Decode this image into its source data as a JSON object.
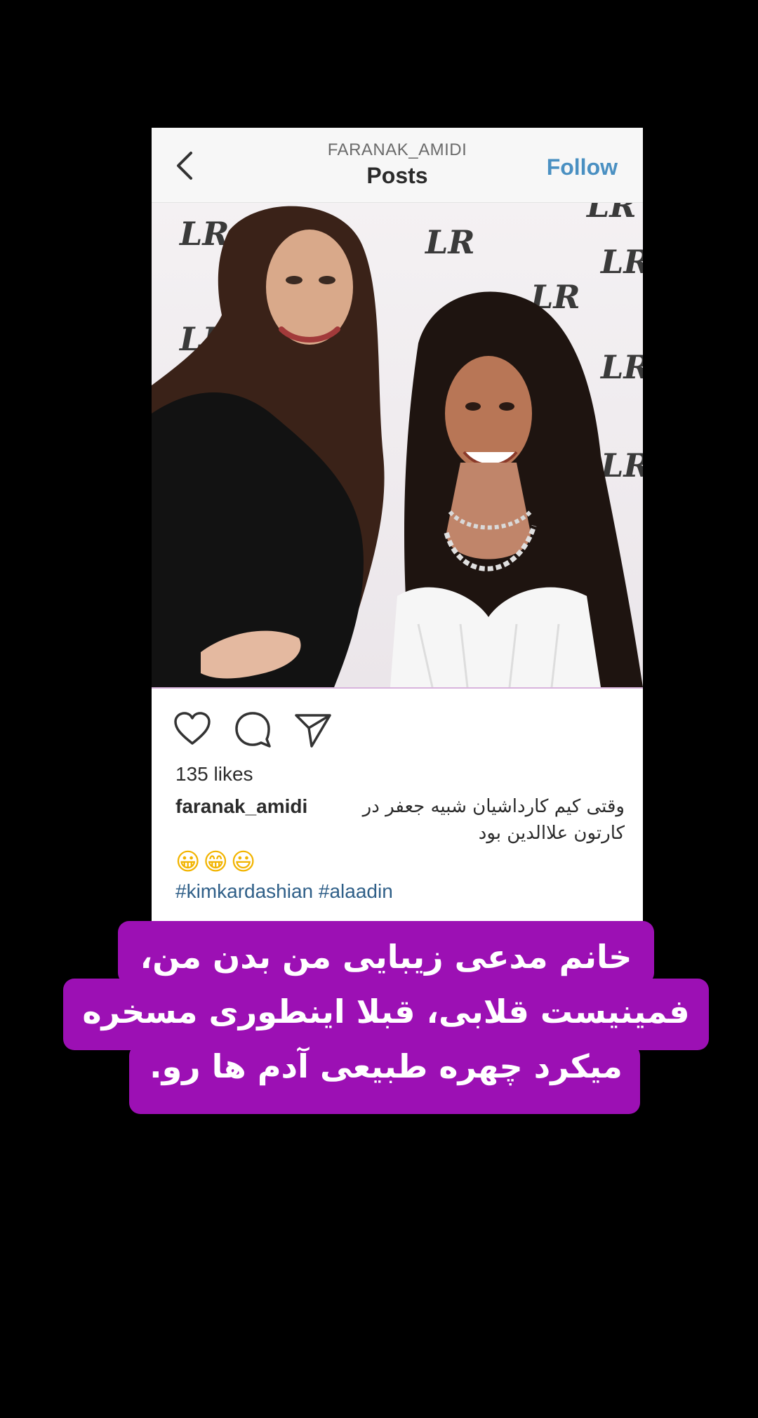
{
  "post_header": {
    "username": "FARANAK_AMIDI",
    "title": "Posts",
    "follow_label": "Follow",
    "back_icon": "chevron-left-icon"
  },
  "photo": {
    "backdrop_logo_text": "LR",
    "description_icon": "photo-of-two-women"
  },
  "actions": {
    "like_icon": "heart-icon",
    "comment_icon": "comment-bubble-icon",
    "share_icon": "paper-plane-icon"
  },
  "likes_text": "135 likes",
  "caption": {
    "username": "faranak_amidi",
    "text": "وقتی کیم کارداشیان شبیه جعفر در کارتون علاالدین بود",
    "emoji": "😀😁😃",
    "hashtags": [
      "#kimkardashian",
      "#alaadin"
    ]
  },
  "overlay_banner": {
    "lines": [
      "خانم مدعی زیبایی من بدن من،",
      "فمینیست قلابی، قبلا اینطوری مسخره",
      "میکرد چهره طبیعی آدم ها رو."
    ],
    "background_color": "#9c10b4",
    "text_color": "#ffffff"
  },
  "colors": {
    "page_background": "#000000",
    "follow_link": "#4a90c2",
    "hashtag": "#2f5f88"
  }
}
